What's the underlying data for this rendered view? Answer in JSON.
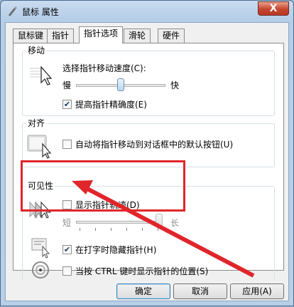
{
  "window": {
    "title": "鼠标 属性",
    "close_label": "X"
  },
  "tabs": [
    {
      "label": "鼠标键"
    },
    {
      "label": "指针"
    },
    {
      "label": "指针选项"
    },
    {
      "label": "滑轮"
    },
    {
      "label": "硬件"
    }
  ],
  "active_tab": "指针选项",
  "motion": {
    "group_label": "移动",
    "speed_label": "选择指针移动速度(C):",
    "slow_label": "慢",
    "fast_label": "快",
    "speed_value": 0.5,
    "precision_label": "提高指针精确度(E)",
    "precision_checked": true
  },
  "snap": {
    "group_label": "对齐",
    "snap_label": "自动将指针移动到对话框中的默认按钮(U)",
    "snap_checked": false
  },
  "visibility": {
    "group_label": "可见性",
    "trails_label": "显示指针轨迹(D)",
    "trails_checked": false,
    "short_label": "短",
    "long_label": "长",
    "trails_value": 1.0,
    "hide_label": "在打字时隐藏指针(H)",
    "hide_checked": true,
    "ctrl_label": "当按 CTRL 键时显示指针的位置(S)",
    "ctrl_checked": false
  },
  "buttons": {
    "ok": "确定",
    "cancel": "取消",
    "apply": "应用(A)"
  },
  "annotation_color": "#e0262b"
}
